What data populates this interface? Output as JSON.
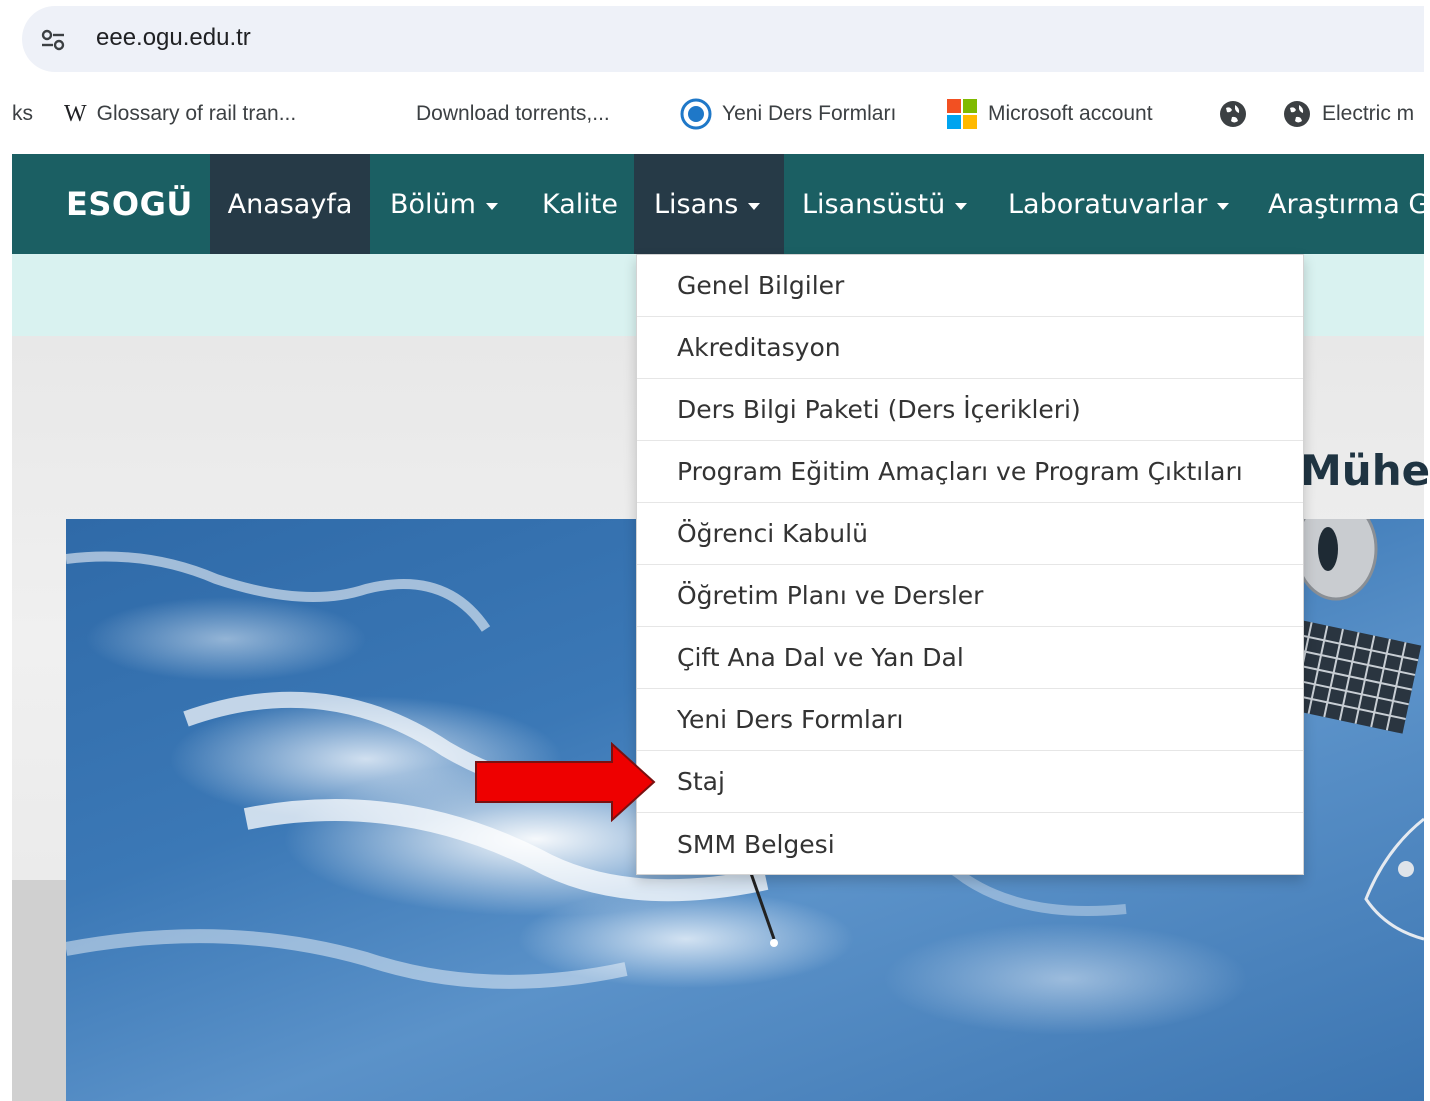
{
  "browser": {
    "url": "eee.ogu.edu.tr"
  },
  "bookmarks": [
    {
      "label": "ks",
      "icon": "none"
    },
    {
      "label": "Glossary of rail tran...",
      "icon": "wikipedia-icon"
    },
    {
      "label": "Download torrents,...",
      "icon": "none"
    },
    {
      "label": "Yeni Ders Formları",
      "icon": "site-icon"
    },
    {
      "label": "Microsoft account",
      "icon": "microsoft-icon"
    },
    {
      "label": "",
      "icon": "globe-icon"
    },
    {
      "label": "Electric m",
      "icon": "globe-icon"
    }
  ],
  "navbar": {
    "brand": "ESOGÜ",
    "items": [
      {
        "label": "Anasayfa",
        "has_caret": false,
        "active": true
      },
      {
        "label": "Bölüm",
        "has_caret": true,
        "active": false
      },
      {
        "label": "Kalite",
        "has_caret": false,
        "active": false
      },
      {
        "label": "Lisans",
        "has_caret": true,
        "active": true
      },
      {
        "label": "Lisansüstü",
        "has_caret": true,
        "active": false
      },
      {
        "label": "Laboratuvarlar",
        "has_caret": true,
        "active": false
      },
      {
        "label": "Araştırma G",
        "has_caret": false,
        "active": false
      }
    ]
  },
  "dropdown": {
    "items": [
      "Genel Bilgiler",
      "Akreditasyon",
      "Ders Bilgi Paketi (Ders İçerikleri)",
      "Program Eğitim Amaçları ve Program Çıktıları",
      "Öğrenci Kabulü",
      "Öğretim Planı ve Dersler",
      "Çift Ana Dal ve Yan Dal",
      "Yeni Ders Formları",
      "Staj",
      "SMM Belgesi"
    ]
  },
  "hero": {
    "title_fragment": "Mühen"
  },
  "colors": {
    "navbar": "#1b5f63",
    "nav_active": "#263a47",
    "strip": "#d9f2f0",
    "annotation_arrow": "#ee0000"
  }
}
